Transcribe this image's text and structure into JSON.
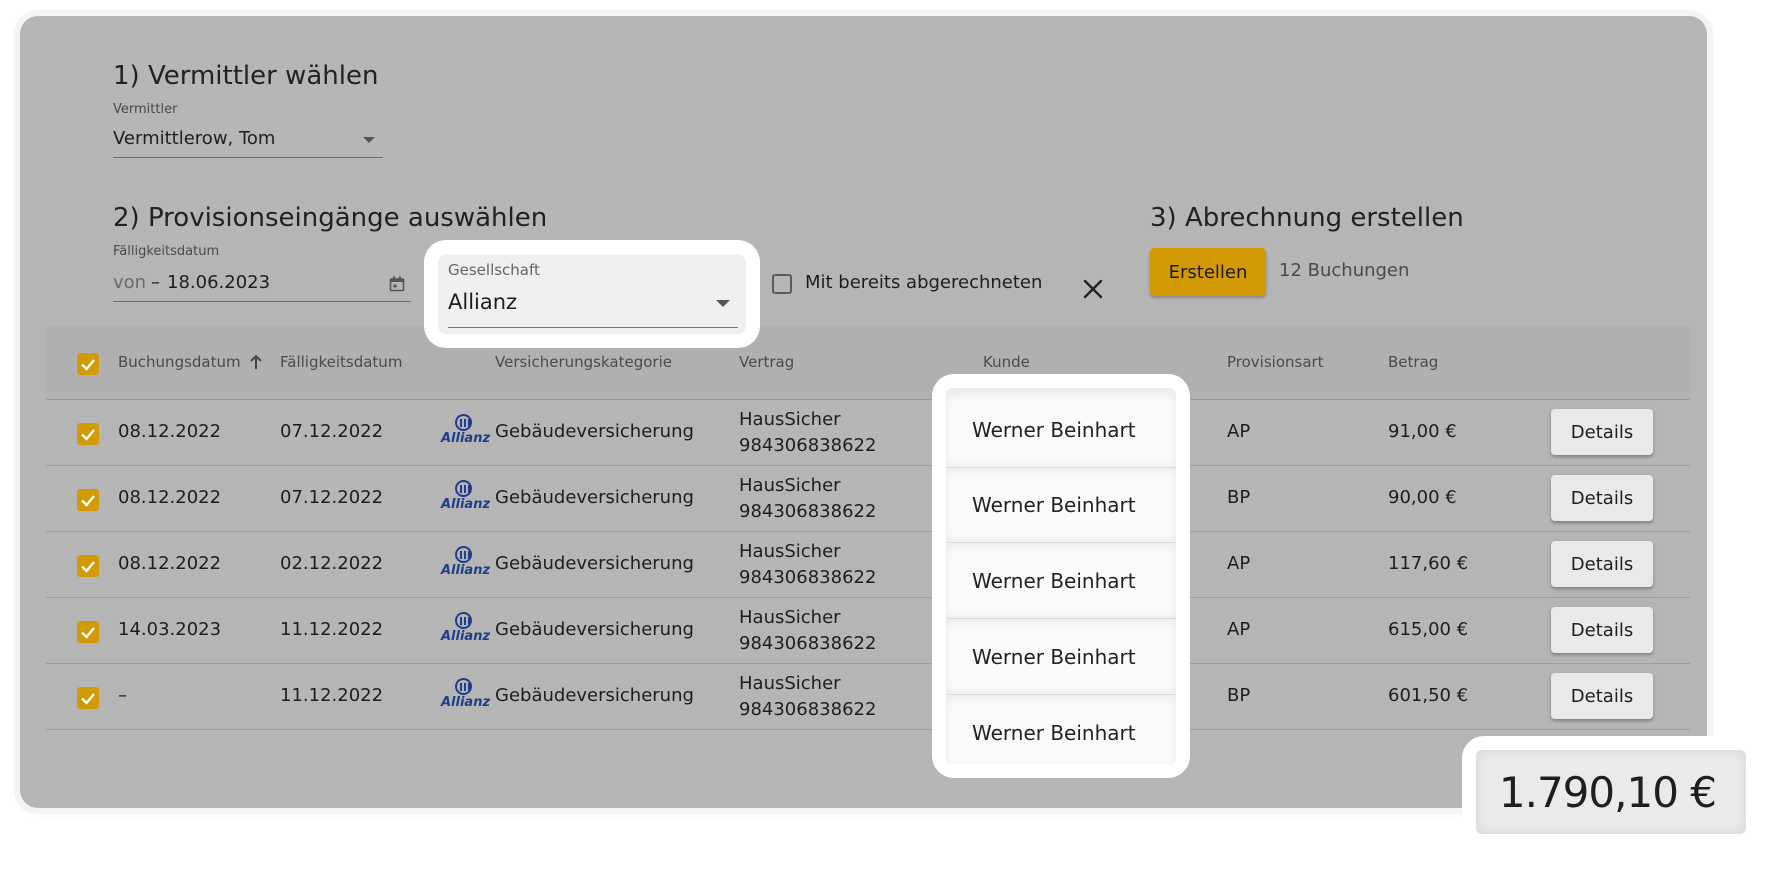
{
  "step1": {
    "title": "1) Vermittler wählen",
    "field_label": "Vermittler",
    "field_value": "Vermittlerow, Tom"
  },
  "step2": {
    "title": "2) Provisionseingänge auswählen",
    "date_label": "Fälligkeitsdatum",
    "date_from_placeholder": "von",
    "date_separator": "–",
    "date_to": "18.06.2023",
    "company_label": "Gesellschaft",
    "company_value": "Allianz",
    "include_settled_label": "Mit bereits abgerechneten",
    "include_settled_checked": false
  },
  "step3": {
    "title": "3) Abrechnung erstellen",
    "create_button": "Erstellen",
    "bookings_count": "12 Buchungen"
  },
  "table": {
    "columns": [
      "Buchungsdatum",
      "Fälligkeitsdatum",
      "Versicherungskategorie",
      "Vertrag",
      "Kunde",
      "Provisionsart",
      "Betrag"
    ],
    "sort_column": "Buchungsdatum",
    "sort_direction": "asc",
    "details_label": "Details",
    "rows": [
      {
        "checked": true,
        "buchungsdatum": "08.12.2022",
        "faelligkeitsdatum": "07.12.2022",
        "logo": "Allianz",
        "kategorie": "Gebäudeversicherung",
        "vertrag_name": "HausSicher",
        "vertrag_nr": "984306838622",
        "kunde": "Werner Beinhart",
        "provisionsart": "AP",
        "betrag": "91,00 €"
      },
      {
        "checked": true,
        "buchungsdatum": "08.12.2022",
        "faelligkeitsdatum": "07.12.2022",
        "logo": "Allianz",
        "kategorie": "Gebäudeversicherung",
        "vertrag_name": "HausSicher",
        "vertrag_nr": "984306838622",
        "kunde": "Werner Beinhart",
        "provisionsart": "BP",
        "betrag": "90,00 €"
      },
      {
        "checked": true,
        "buchungsdatum": "08.12.2022",
        "faelligkeitsdatum": "02.12.2022",
        "logo": "Allianz",
        "kategorie": "Gebäudeversicherung",
        "vertrag_name": "HausSicher",
        "vertrag_nr": "984306838622",
        "kunde": "Werner Beinhart",
        "provisionsart": "AP",
        "betrag": "117,60 €"
      },
      {
        "checked": true,
        "buchungsdatum": "14.03.2023",
        "faelligkeitsdatum": "11.12.2022",
        "logo": "Allianz",
        "kategorie": "Gebäudeversicherung",
        "vertrag_name": "HausSicher",
        "vertrag_nr": "984306838622",
        "kunde": "Werner Beinhart",
        "provisionsart": "AP",
        "betrag": "615,00 €"
      },
      {
        "checked": true,
        "buchungsdatum": "–",
        "faelligkeitsdatum": "11.12.2022",
        "logo": "Allianz",
        "kategorie": "Gebäudeversicherung",
        "vertrag_name": "HausSicher",
        "vertrag_nr": "984306838622",
        "kunde": "Werner Beinhart",
        "provisionsart": "BP",
        "betrag": "601,50 €"
      }
    ]
  },
  "total": "1.790,10 €",
  "colors": {
    "accent": "#d49a06",
    "overlay_bg": "#b5b5b5",
    "logo_blue": "#1f3f8a"
  },
  "icons": {
    "dropdown": "chevron-down-icon",
    "calendar": "calendar-icon",
    "clear": "close-icon",
    "sort": "arrow-up-icon",
    "check": "check-icon"
  }
}
